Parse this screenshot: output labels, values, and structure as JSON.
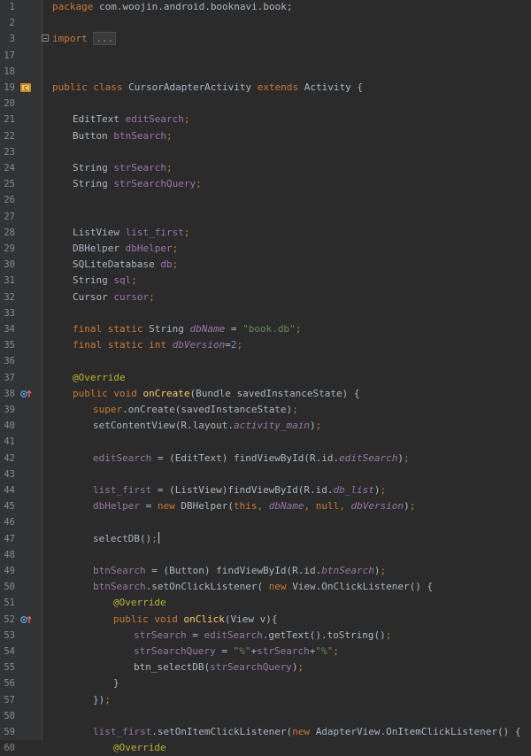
{
  "editor": {
    "lines": [
      {
        "n": "1",
        "indent": 0,
        "tokens": [
          [
            "kw",
            "package "
          ],
          [
            "p",
            "com.woojin.android.booknavi.book;"
          ]
        ]
      },
      {
        "n": "2",
        "indent": 0,
        "tokens": []
      },
      {
        "n": "3",
        "indent": 0,
        "fold": true,
        "tokens": [
          [
            "kw",
            "import "
          ],
          [
            "folded",
            "..."
          ]
        ]
      },
      {
        "n": "17",
        "indent": 0,
        "tokens": []
      },
      {
        "n": "18",
        "indent": 0,
        "tokens": []
      },
      {
        "n": "19",
        "indent": 0,
        "gicon": "class-icon",
        "tokens": [
          [
            "kw",
            "public class "
          ],
          [
            "p",
            "CursorAdapterActivity "
          ],
          [
            "kw",
            "extends "
          ],
          [
            "p",
            "Activity {"
          ]
        ]
      },
      {
        "n": "20",
        "indent": 0,
        "tokens": []
      },
      {
        "n": "21",
        "indent": 1,
        "tokens": [
          [
            "p",
            "EditText "
          ],
          [
            "fld",
            "editSearch"
          ],
          [
            "kw",
            ";"
          ]
        ]
      },
      {
        "n": "22",
        "indent": 1,
        "tokens": [
          [
            "p",
            "Button "
          ],
          [
            "fld",
            "btnSearch"
          ],
          [
            "kw",
            ";"
          ]
        ]
      },
      {
        "n": "23",
        "indent": 0,
        "tokens": []
      },
      {
        "n": "24",
        "indent": 1,
        "tokens": [
          [
            "p",
            "String "
          ],
          [
            "fld",
            "strSearch"
          ],
          [
            "kw",
            ";"
          ]
        ]
      },
      {
        "n": "25",
        "indent": 1,
        "tokens": [
          [
            "p",
            "String "
          ],
          [
            "fld",
            "strSearchQuery"
          ],
          [
            "kw",
            ";"
          ]
        ]
      },
      {
        "n": "26",
        "indent": 0,
        "tokens": []
      },
      {
        "n": "27",
        "indent": 0,
        "tokens": []
      },
      {
        "n": "28",
        "indent": 1,
        "tokens": [
          [
            "p",
            "ListView "
          ],
          [
            "fld",
            "list_first"
          ],
          [
            "kw",
            ";"
          ]
        ]
      },
      {
        "n": "29",
        "indent": 1,
        "tokens": [
          [
            "p",
            "DBHelper "
          ],
          [
            "fld",
            "dbHelper"
          ],
          [
            "kw",
            ";"
          ]
        ]
      },
      {
        "n": "30",
        "indent": 1,
        "tokens": [
          [
            "p",
            "SQLiteDatabase "
          ],
          [
            "fld",
            "db"
          ],
          [
            "kw",
            ";"
          ]
        ]
      },
      {
        "n": "31",
        "indent": 1,
        "tokens": [
          [
            "p",
            "String "
          ],
          [
            "fld",
            "sql"
          ],
          [
            "kw",
            ";"
          ]
        ]
      },
      {
        "n": "32",
        "indent": 1,
        "tokens": [
          [
            "p",
            "Cursor "
          ],
          [
            "fld",
            "cursor"
          ],
          [
            "kw",
            ";"
          ]
        ]
      },
      {
        "n": "33",
        "indent": 0,
        "tokens": []
      },
      {
        "n": "34",
        "indent": 1,
        "tokens": [
          [
            "kw",
            "final static "
          ],
          [
            "p",
            "String "
          ],
          [
            "sfld",
            "dbName"
          ],
          [
            "p",
            " = "
          ],
          [
            "str",
            "\"book.db\""
          ],
          [
            "kw",
            ";"
          ]
        ]
      },
      {
        "n": "35",
        "indent": 1,
        "tokens": [
          [
            "kw",
            "final static int "
          ],
          [
            "sfld",
            "dbVersion"
          ],
          [
            "p",
            "="
          ],
          [
            "num",
            "2"
          ],
          [
            "kw",
            ";"
          ]
        ]
      },
      {
        "n": "36",
        "indent": 0,
        "tokens": []
      },
      {
        "n": "37",
        "indent": 1,
        "tokens": [
          [
            "ann",
            "@Override"
          ]
        ]
      },
      {
        "n": "38",
        "indent": 1,
        "gicon": "override-icon",
        "tokens": [
          [
            "kw",
            "public void "
          ],
          [
            "fn",
            "onCreate"
          ],
          [
            "p",
            "(Bundle savedInstanceState) {"
          ]
        ]
      },
      {
        "n": "39",
        "indent": 2,
        "tokens": [
          [
            "kw",
            "super"
          ],
          [
            "p",
            ".onCreate(savedInstanceState)"
          ],
          [
            "kw",
            ";"
          ]
        ]
      },
      {
        "n": "40",
        "indent": 2,
        "tokens": [
          [
            "p",
            "setContentView(R.layout."
          ],
          [
            "sfld",
            "activity_main"
          ],
          [
            "p",
            ")"
          ],
          [
            "kw",
            ";"
          ]
        ]
      },
      {
        "n": "41",
        "indent": 0,
        "tokens": []
      },
      {
        "n": "42",
        "indent": 2,
        "tokens": [
          [
            "fld",
            "editSearch"
          ],
          [
            "p",
            " = (EditText) findViewById(R.id."
          ],
          [
            "sfld",
            "editSearch"
          ],
          [
            "p",
            ")"
          ],
          [
            "kw",
            ";"
          ]
        ]
      },
      {
        "n": "43",
        "indent": 0,
        "tokens": []
      },
      {
        "n": "44",
        "indent": 2,
        "tokens": [
          [
            "fld",
            "list_first"
          ],
          [
            "p",
            " = (ListView)findViewById(R.id."
          ],
          [
            "sfld",
            "db_list"
          ],
          [
            "p",
            ")"
          ],
          [
            "kw",
            ";"
          ]
        ]
      },
      {
        "n": "45",
        "indent": 2,
        "tokens": [
          [
            "fld",
            "dbHelper"
          ],
          [
            "p",
            " = "
          ],
          [
            "kw",
            "new "
          ],
          [
            "p",
            "DBHelper("
          ],
          [
            "kw",
            "this, "
          ],
          [
            "sfld",
            "dbName"
          ],
          [
            "kw",
            ", null, "
          ],
          [
            "sfld",
            "dbVersion"
          ],
          [
            "p",
            ")"
          ],
          [
            "kw",
            ";"
          ]
        ]
      },
      {
        "n": "46",
        "indent": 0,
        "tokens": []
      },
      {
        "n": "47",
        "indent": 2,
        "caret": true,
        "tokens": [
          [
            "p",
            "selectDB()"
          ],
          [
            "kw",
            ";"
          ]
        ]
      },
      {
        "n": "48",
        "indent": 0,
        "tokens": []
      },
      {
        "n": "49",
        "indent": 2,
        "tokens": [
          [
            "fld",
            "btnSearch"
          ],
          [
            "p",
            " = (Button) findViewById(R.id."
          ],
          [
            "sfld",
            "btnSearch"
          ],
          [
            "p",
            ")"
          ],
          [
            "kw",
            ";"
          ]
        ]
      },
      {
        "n": "50",
        "indent": 2,
        "tokens": [
          [
            "fld",
            "btnSearch"
          ],
          [
            "p",
            ".setOnClickListener( "
          ],
          [
            "kw",
            "new "
          ],
          [
            "p",
            "View.OnClickListener() {"
          ]
        ]
      },
      {
        "n": "51",
        "indent": 3,
        "tokens": [
          [
            "ann",
            "@Override"
          ]
        ]
      },
      {
        "n": "52",
        "indent": 3,
        "gicon": "override-icon",
        "tokens": [
          [
            "kw",
            "public void "
          ],
          [
            "fn",
            "onClick"
          ],
          [
            "p",
            "(View v){"
          ]
        ]
      },
      {
        "n": "53",
        "indent": 4,
        "tokens": [
          [
            "fld",
            "strSearch"
          ],
          [
            "p",
            " = "
          ],
          [
            "fld",
            "editSearch"
          ],
          [
            "p",
            ".getText().toString()"
          ],
          [
            "kw",
            ";"
          ]
        ]
      },
      {
        "n": "54",
        "indent": 4,
        "tokens": [
          [
            "fld",
            "strSearchQuery"
          ],
          [
            "p",
            " = "
          ],
          [
            "str",
            "\"%\""
          ],
          [
            "p",
            "+"
          ],
          [
            "fld",
            "strSearch"
          ],
          [
            "p",
            "+"
          ],
          [
            "str",
            "\"%\""
          ],
          [
            "kw",
            ";"
          ]
        ]
      },
      {
        "n": "55",
        "indent": 4,
        "tokens": [
          [
            "p",
            "btn_selectDB("
          ],
          [
            "fld",
            "strSearchQuery"
          ],
          [
            "p",
            ")"
          ],
          [
            "kw",
            ";"
          ]
        ]
      },
      {
        "n": "56",
        "indent": 3,
        "tokens": [
          [
            "p",
            "}"
          ]
        ]
      },
      {
        "n": "57",
        "indent": 2,
        "tokens": [
          [
            "p",
            "})"
          ],
          [
            "kw",
            ";"
          ]
        ]
      },
      {
        "n": "58",
        "indent": 0,
        "tokens": []
      },
      {
        "n": "59",
        "indent": 2,
        "tokens": [
          [
            "fld",
            "list_first"
          ],
          [
            "p",
            ".setOnItemClickListener("
          ],
          [
            "kw",
            "new "
          ],
          [
            "p",
            "AdapterView.OnItemClickListener() {"
          ]
        ]
      },
      {
        "n": "60",
        "indent": 3,
        "tokens": [
          [
            "ann",
            "@Override"
          ]
        ]
      }
    ]
  }
}
